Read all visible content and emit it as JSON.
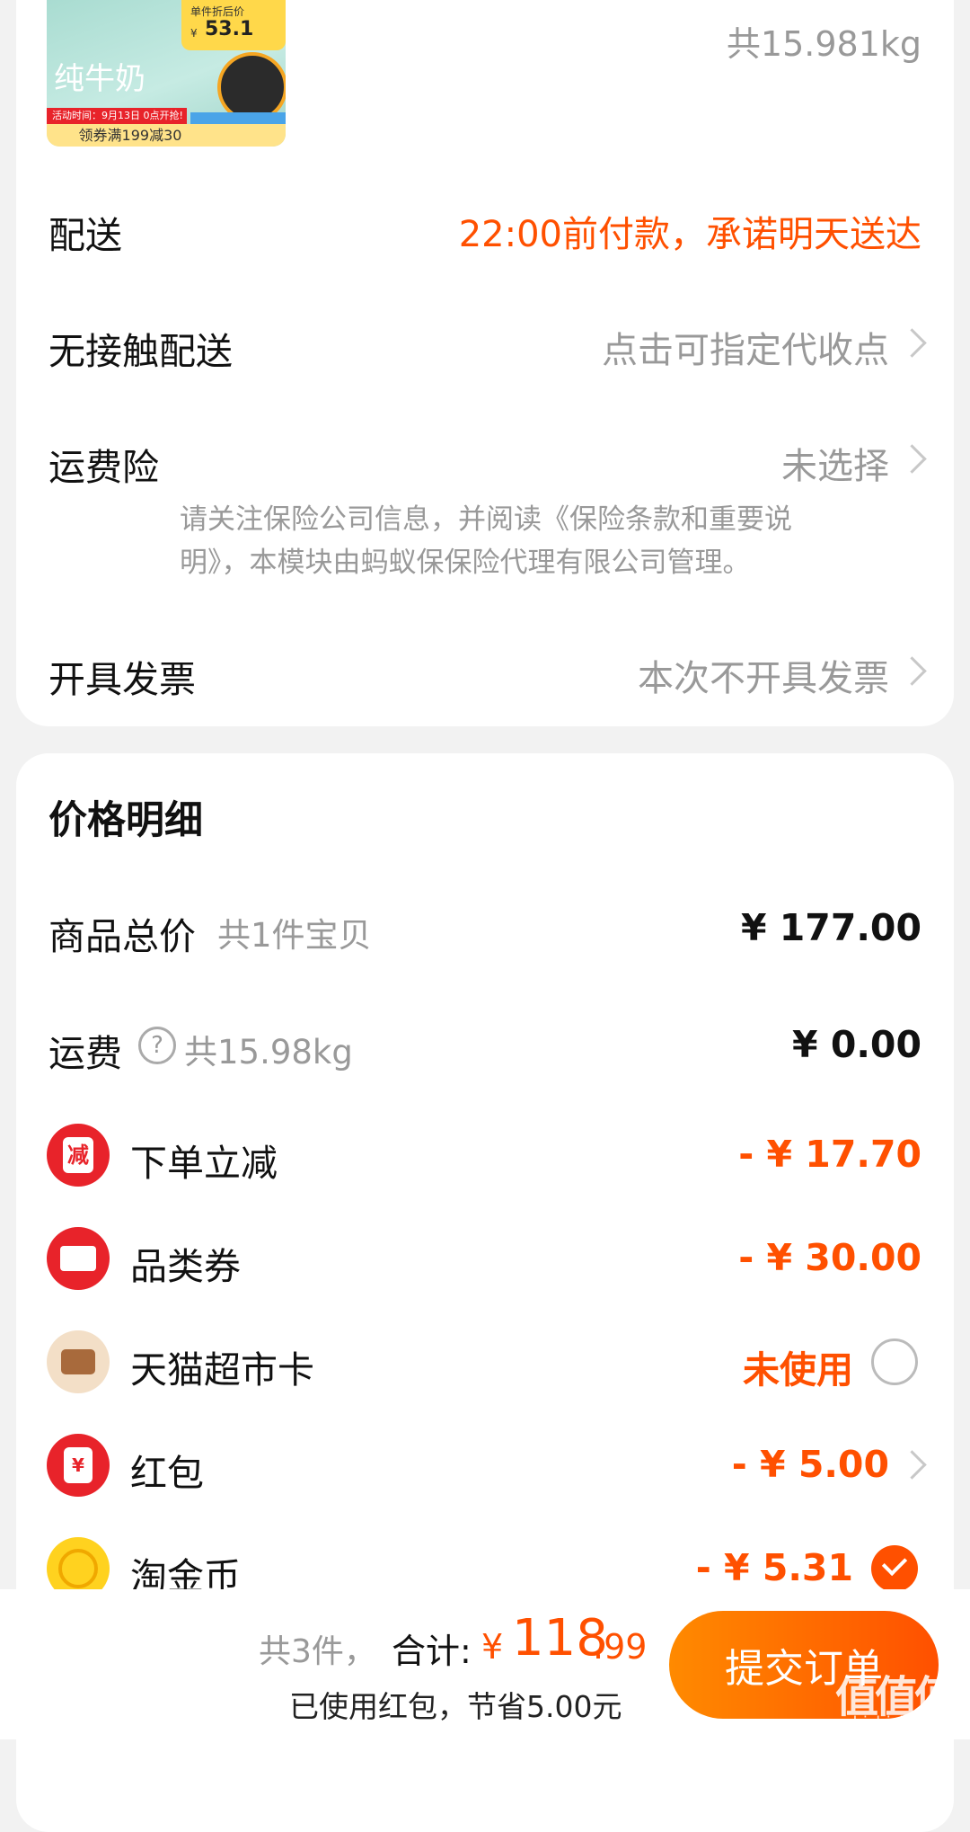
{
  "product": {
    "image_texts": [
      "纯牛奶",
      "单件折后价",
      "¥",
      "53.1",
      "活动时间：9月13日 0点开抢!",
      "领券满199减30"
    ],
    "weight_total": "共15.981kg"
  },
  "order_rows": [
    {
      "label": "配送",
      "value": "22:00前付款，承诺明天送达"
    },
    {
      "label": "无接触配送",
      "value": "点击可指定代收点"
    },
    {
      "label": "运费险",
      "value": "未选择",
      "note_line1": "请关注保险公司信息，并阅读《保险条款和重要说",
      "note_line2": "明》，本模块由蚂蚁保保险代理有限公司管理。"
    },
    {
      "label": "开具发票",
      "value": "本次不开具发票"
    }
  ],
  "price_detail": {
    "title": "价格明细",
    "goods_total": {
      "label": "商品总价",
      "sub": "共1件宝贝",
      "value": "¥ 177.00"
    },
    "shipping": {
      "label": "运费",
      "help_glyph": "?",
      "sub": "共15.98kg",
      "value": "¥ 0.00"
    },
    "discounts": [
      {
        "icon": "red-envelope-icon",
        "icon_glyph": "减",
        "label": "下单立减",
        "value": "- ¥ 17.70"
      },
      {
        "icon": "ticket-icon",
        "label": "品类券",
        "value": "- ¥ 30.00"
      },
      {
        "icon": "card-icon",
        "label": "天猫超市卡",
        "value": "未使用"
      },
      {
        "icon": "hongbao-icon",
        "icon_glyph": "¥",
        "label": "红包",
        "value": "- ¥ 5.00"
      },
      {
        "icon": "coin-icon",
        "label": "淘金币",
        "value": "- ¥ 5.31"
      }
    ]
  },
  "footer": {
    "count": "共3件，",
    "total_label": "合计:",
    "currency": "¥",
    "total_int": "118",
    "total_dec": ".99",
    "saved": "已使用红包，节省5.00元",
    "submit": "提交订单"
  },
  "watermark": {
    "text": "值值值",
    "url": "zhizhizhi.com"
  },
  "colors": {
    "accent": "#ff5000",
    "red": "#e8232a",
    "gold": "#ffd21f"
  }
}
